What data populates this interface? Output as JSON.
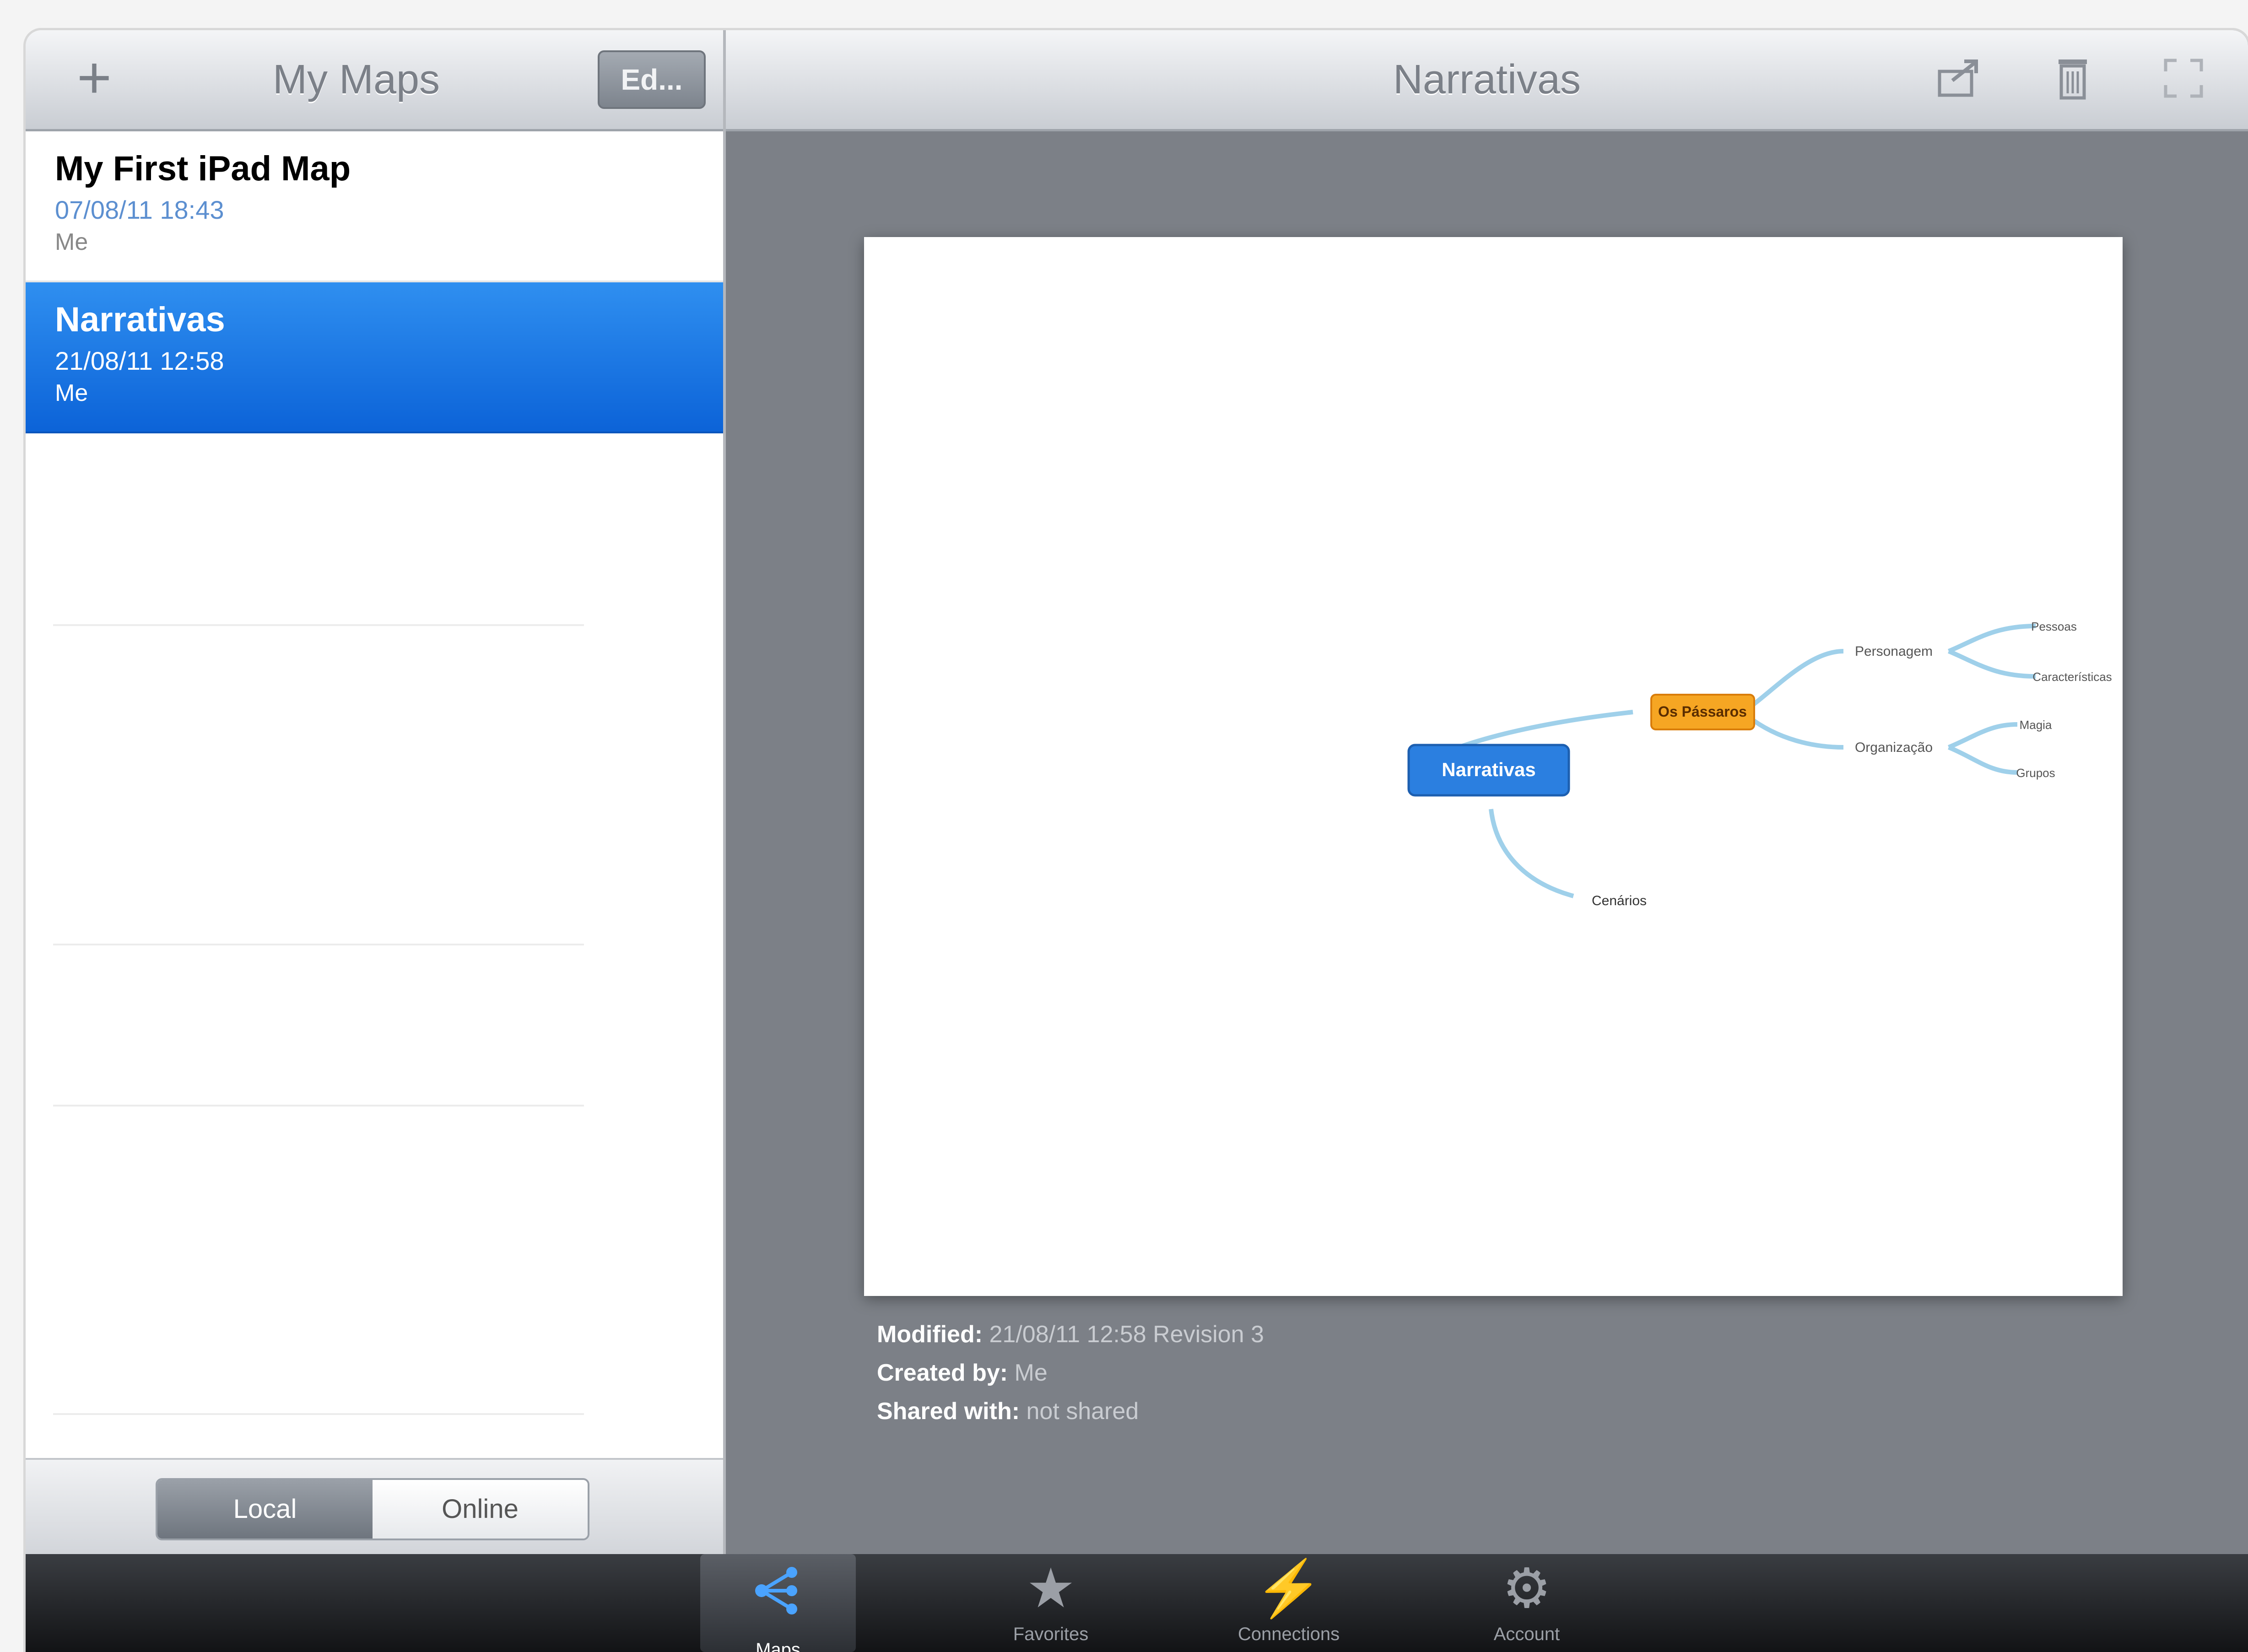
{
  "master": {
    "title": "My Maps",
    "add_label": "+",
    "edit_label": "Ed..."
  },
  "maps": [
    {
      "name": "My First iPad Map",
      "date": "07/08/11 18:43",
      "owner": "Me"
    },
    {
      "name": "Narrativas",
      "date": "21/08/11 12:58",
      "owner": "Me"
    }
  ],
  "segmented": {
    "local": "Local",
    "online": "Online"
  },
  "detail": {
    "title": "Narrativas",
    "icons": [
      "share-icon",
      "trash-icon",
      "fullscreen-icon"
    ]
  },
  "mindmap": {
    "root": "Narrativas",
    "main": "Os Pássaros",
    "branches": [
      "Personagem",
      "Organização"
    ],
    "leaves": [
      "Pessoas",
      "Características",
      "Magia",
      "Grupos"
    ],
    "child": "Cenários"
  },
  "meta": {
    "modified_label": "Modified:",
    "modified_value": "21/08/11 12:58 Revision 3",
    "created_label": "Created by:",
    "created_value": "Me",
    "shared_label": "Shared with:",
    "shared_value": "not shared"
  },
  "tabs": [
    {
      "label": "Maps",
      "icon": "mindmap-icon"
    },
    {
      "label": "Favorites",
      "icon": "star-icon"
    },
    {
      "label": "Connections",
      "icon": "lightning-icon"
    },
    {
      "label": "Account",
      "icon": "gear-icon"
    }
  ],
  "colors": {
    "selection": "#1a74e6",
    "root_node": "#2b7fe0",
    "main_node": "#f6a623",
    "chrome": "#c9cdd3",
    "background": "#7c8087"
  }
}
